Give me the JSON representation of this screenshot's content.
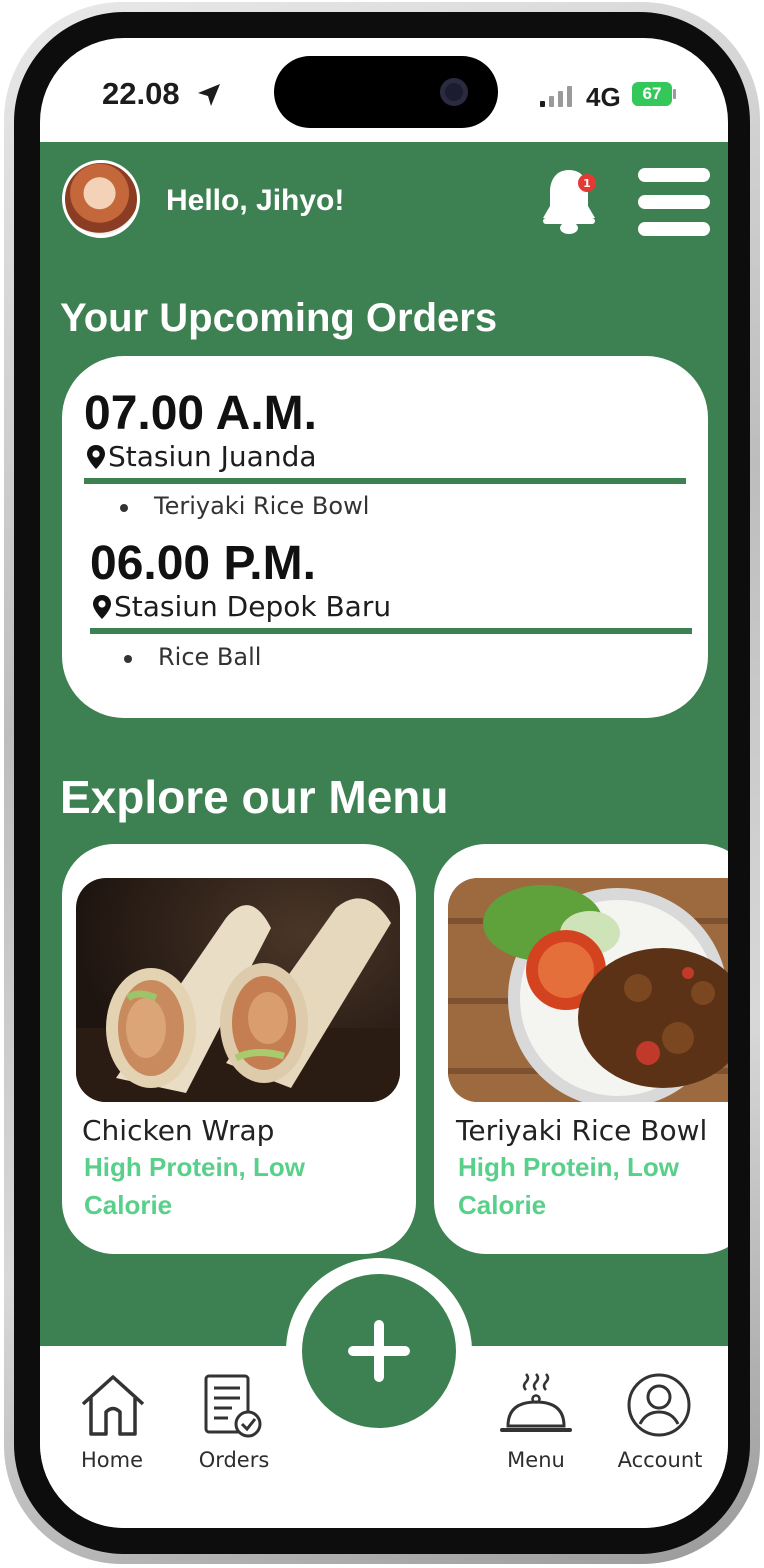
{
  "status_bar": {
    "time": "22.08",
    "network": "4G",
    "battery": "67"
  },
  "header": {
    "greeting": "Hello, Jihyo!",
    "notification_count": "1"
  },
  "upcoming": {
    "title": "Your Upcoming Orders",
    "orders": [
      {
        "time": "07.00 A.M.",
        "location": "Stasiun Juanda",
        "items": [
          "Teriyaki Rice Bowl"
        ]
      },
      {
        "time": "06.00 P.M.",
        "location": "Stasiun Depok Baru",
        "items": [
          "Rice Ball"
        ]
      }
    ]
  },
  "menu": {
    "title": "Explore our Menu",
    "items": [
      {
        "name": "Chicken Wrap",
        "tags": "High Protein, Low Calorie"
      },
      {
        "name": "Teriyaki Rice Bowl",
        "tags": "High Protein, Low Calorie"
      }
    ]
  },
  "nav": {
    "home": "Home",
    "orders": "Orders",
    "menu": "Menu",
    "account": "Account"
  },
  "colors": {
    "brand_green": "#3d8052",
    "tag_green": "#58d08a"
  },
  "icons": [
    "location-arrow-icon",
    "signal-icon",
    "bell-icon",
    "hamburger-icon",
    "pin-icon",
    "home-icon",
    "orders-icon",
    "cloche-icon",
    "account-icon",
    "plus-icon"
  ]
}
